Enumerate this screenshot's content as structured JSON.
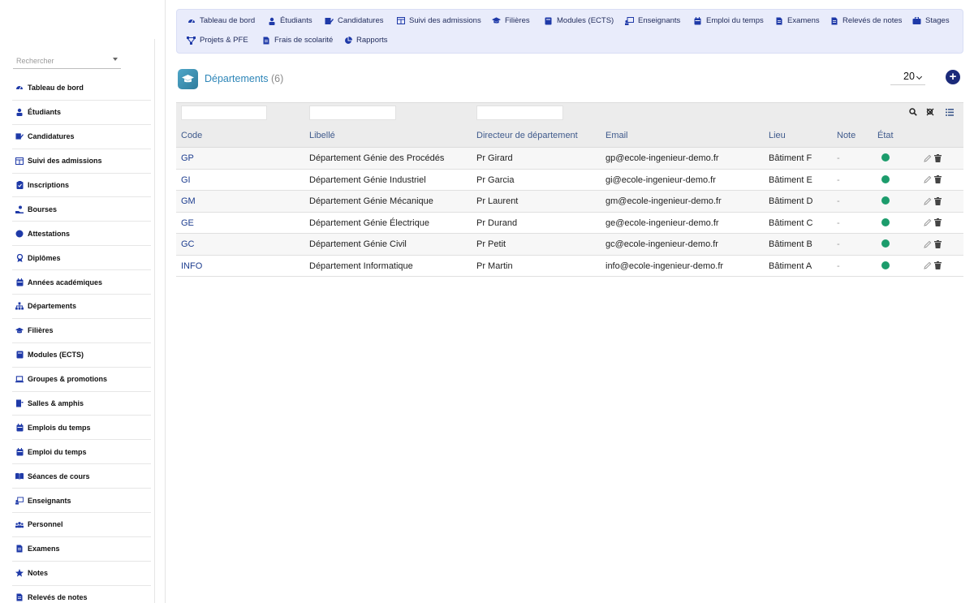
{
  "sidebar": {
    "search": {
      "placeholder": "Rechercher"
    },
    "items": [
      {
        "label": "Tableau de bord",
        "icon": "dashboard-icon"
      },
      {
        "label": "Étudiants",
        "icon": "student-icon"
      },
      {
        "label": "Candidatures",
        "icon": "application-icon"
      },
      {
        "label": "Suivi des admissions",
        "icon": "table-icon"
      },
      {
        "label": "Inscriptions",
        "icon": "clipboard-icon"
      },
      {
        "label": "Bourses",
        "icon": "hand-coin-icon"
      },
      {
        "label": "Attestations",
        "icon": "certificate-icon"
      },
      {
        "label": "Diplômes",
        "icon": "diploma-icon"
      },
      {
        "label": "Années académiques",
        "icon": "calendar-icon"
      },
      {
        "label": "Départements",
        "icon": "sitemap-icon"
      },
      {
        "label": "Filières",
        "icon": "graduation-cap-icon"
      },
      {
        "label": "Modules (ECTS)",
        "icon": "book-icon"
      },
      {
        "label": "Groupes & promotions",
        "icon": "laptop-icon"
      },
      {
        "label": "Salles & amphis",
        "icon": "door-icon"
      },
      {
        "label": "Emplois du temps",
        "icon": "calendar-icon"
      },
      {
        "label": "Emploi du temps",
        "icon": "calendar-icon"
      },
      {
        "label": "Séances de cours",
        "icon": "open-book-icon"
      },
      {
        "label": "Enseignants",
        "icon": "teacher-icon"
      },
      {
        "label": "Personnel",
        "icon": "users-icon"
      },
      {
        "label": "Examens",
        "icon": "document-icon"
      },
      {
        "label": "Notes",
        "icon": "star-icon"
      },
      {
        "label": "Relevés de notes",
        "icon": "document-icon"
      }
    ]
  },
  "topnav": {
    "row1": [
      {
        "label": "Tableau de bord",
        "icon": "dashboard-icon"
      },
      {
        "label": "Étudiants",
        "icon": "student-icon"
      },
      {
        "label": "Candidatures",
        "icon": "application-icon"
      },
      {
        "label": "Suivi des admissions",
        "icon": "table-icon"
      },
      {
        "label": "Filières",
        "icon": "graduation-cap-icon"
      },
      {
        "label": "Modules (ECTS)",
        "icon": "book-icon"
      },
      {
        "label": "Enseignants",
        "icon": "teacher-icon"
      },
      {
        "label": "Emploi du temps",
        "icon": "calendar-icon"
      },
      {
        "label": "Examens",
        "icon": "document-icon"
      },
      {
        "label": "Relevés de notes",
        "icon": "document-icon"
      },
      {
        "label": "Stages",
        "icon": "briefcase-icon"
      }
    ],
    "row2": [
      {
        "label": "Projets & PFE",
        "icon": "project-icon"
      },
      {
        "label": "Frais de scolarité",
        "icon": "invoice-icon"
      },
      {
        "label": "Rapports",
        "icon": "pie-chart-icon"
      }
    ]
  },
  "header": {
    "title": "Départements",
    "count": "(6)",
    "page_size": "20",
    "add_label": "+"
  },
  "table": {
    "columns": [
      "Code",
      "Libellé",
      "Directeur de département",
      "Email",
      "Lieu",
      "Note",
      "État"
    ],
    "rows": [
      {
        "code": "GP",
        "label": "Département Génie des Procédés",
        "director": "Pr Girard",
        "email": "gp@ecole-ingenieur-demo.fr",
        "place": "Bâtiment F",
        "note": "-",
        "status": "active"
      },
      {
        "code": "GI",
        "label": "Département Génie Industriel",
        "director": "Pr Garcia",
        "email": "gi@ecole-ingenieur-demo.fr",
        "place": "Bâtiment E",
        "note": "-",
        "status": "active"
      },
      {
        "code": "GM",
        "label": "Département Génie Mécanique",
        "director": "Pr Laurent",
        "email": "gm@ecole-ingenieur-demo.fr",
        "place": "Bâtiment D",
        "note": "-",
        "status": "active"
      },
      {
        "code": "GE",
        "label": "Département Génie Électrique",
        "director": "Pr Durand",
        "email": "ge@ecole-ingenieur-demo.fr",
        "place": "Bâtiment C",
        "note": "-",
        "status": "active"
      },
      {
        "code": "GC",
        "label": "Département Génie Civil",
        "director": "Pr Petit",
        "email": "gc@ecole-ingenieur-demo.fr",
        "place": "Bâtiment B",
        "note": "-",
        "status": "active"
      },
      {
        "code": "INFO",
        "label": "Département Informatique",
        "director": "Pr Martin",
        "email": "info@ecole-ingenieur-demo.fr",
        "place": "Bâtiment A",
        "note": "-",
        "status": "active"
      }
    ]
  },
  "colors": {
    "accent": "#2e86b8",
    "nav_bg": "#e9ecfb",
    "status_active": "#1c9c6c",
    "add_button": "#1b2a7a"
  }
}
